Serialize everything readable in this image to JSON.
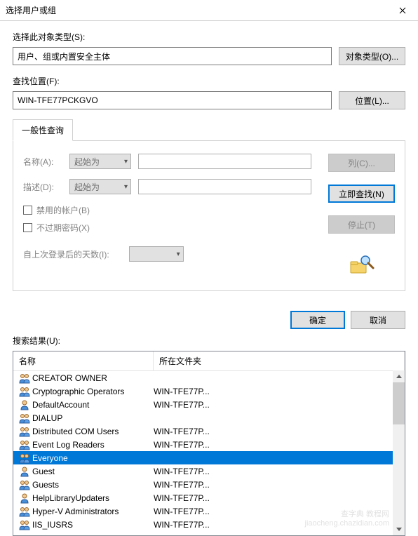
{
  "window": {
    "title": "选择用户或组"
  },
  "objectType": {
    "label": "选择此对象类型(S):",
    "value": "用户、组或内置安全主体",
    "button": "对象类型(O)..."
  },
  "location": {
    "label": "查找位置(F):",
    "value": "WIN-TFE77PCKGVO",
    "button": "位置(L)..."
  },
  "tabs": {
    "general": "一般性查询"
  },
  "query": {
    "nameLabel": "名称(A):",
    "nameMatch": "起始为",
    "descLabel": "描述(D):",
    "descMatch": "起始为",
    "disabledAccounts": "禁用的帐户(B)",
    "nonExpiringPwd": "不过期密码(X)",
    "daysLabel": "自上次登录后的天数(I):"
  },
  "sideButtons": {
    "columns": "列(C)...",
    "findNow": "立即查找(N)",
    "stop": "停止(T)"
  },
  "actions": {
    "ok": "确定",
    "cancel": "取消"
  },
  "results": {
    "label": "搜索结果(U):",
    "columns": {
      "name": "名称",
      "folder": "所在文件夹"
    },
    "rows": [
      {
        "icon": "group",
        "name": "CREATOR OWNER",
        "folder": "",
        "selected": false
      },
      {
        "icon": "group",
        "name": "Cryptographic Operators",
        "folder": "WIN-TFE77P...",
        "selected": false
      },
      {
        "icon": "user",
        "name": "DefaultAccount",
        "folder": "WIN-TFE77P...",
        "selected": false
      },
      {
        "icon": "group",
        "name": "DIALUP",
        "folder": "",
        "selected": false
      },
      {
        "icon": "group",
        "name": "Distributed COM Users",
        "folder": "WIN-TFE77P...",
        "selected": false
      },
      {
        "icon": "group",
        "name": "Event Log Readers",
        "folder": "WIN-TFE77P...",
        "selected": false
      },
      {
        "icon": "group",
        "name": "Everyone",
        "folder": "",
        "selected": true
      },
      {
        "icon": "user",
        "name": "Guest",
        "folder": "WIN-TFE77P...",
        "selected": false
      },
      {
        "icon": "group",
        "name": "Guests",
        "folder": "WIN-TFE77P...",
        "selected": false
      },
      {
        "icon": "user",
        "name": "HelpLibraryUpdaters",
        "folder": "WIN-TFE77P...",
        "selected": false
      },
      {
        "icon": "group",
        "name": "Hyper-V Administrators",
        "folder": "WIN-TFE77P...",
        "selected": false
      },
      {
        "icon": "group",
        "name": "IIS_IUSRS",
        "folder": "WIN-TFE77P...",
        "selected": false
      }
    ]
  },
  "watermark": {
    "line1": "查字典 教程网",
    "line2": "jiaocheng.chazidian.com"
  }
}
